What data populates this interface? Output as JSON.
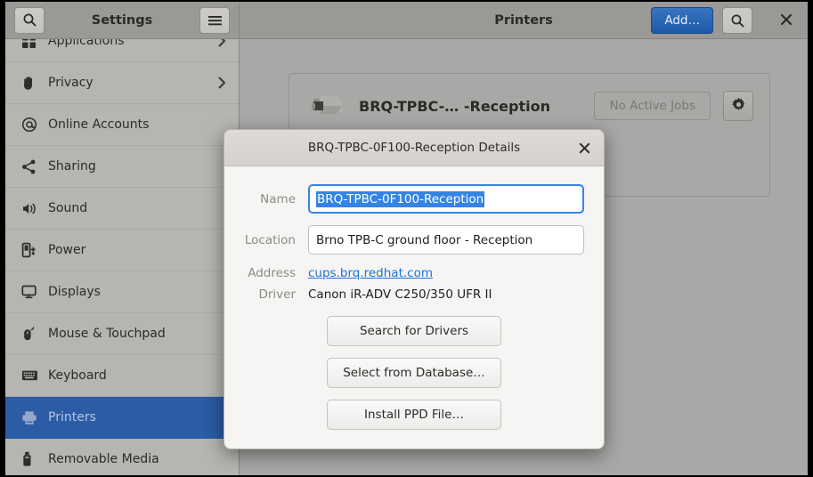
{
  "window": {
    "sidebar_title": "Settings",
    "content_title": "Printers"
  },
  "header": {
    "search_icon": "search-icon",
    "menu_icon": "hamburger-menu-icon",
    "add_label": "Add…",
    "content_search_icon": "search-icon",
    "close_icon": "close-icon"
  },
  "sidebar": {
    "items": [
      {
        "label": "Applications",
        "icon": "applications-grid-icon",
        "chevron": "›",
        "selected": false,
        "partial": true
      },
      {
        "label": "Privacy",
        "icon": "hand-icon",
        "chevron": "›",
        "selected": false
      },
      {
        "label": "Online Accounts",
        "icon": "at-sign-icon",
        "chevron": "",
        "selected": false
      },
      {
        "label": "Sharing",
        "icon": "share-nodes-icon",
        "chevron": "",
        "selected": false
      },
      {
        "label": "Sound",
        "icon": "speaker-icon",
        "chevron": "",
        "selected": false
      },
      {
        "label": "Power",
        "icon": "battery-plug-icon",
        "chevron": "",
        "selected": false
      },
      {
        "label": "Displays",
        "icon": "monitor-icon",
        "chevron": "",
        "selected": false
      },
      {
        "label": "Mouse & Touchpad",
        "icon": "mouse-icon",
        "chevron": "",
        "selected": false
      },
      {
        "label": "Keyboard",
        "icon": "keyboard-icon",
        "chevron": "",
        "selected": false
      },
      {
        "label": "Printers",
        "icon": "printer-icon",
        "chevron": "",
        "selected": true
      },
      {
        "label": "Removable Media",
        "icon": "usb-drive-icon",
        "chevron": "",
        "selected": false
      }
    ]
  },
  "printer_card": {
    "icon": "printer-icon",
    "name": "BRQ-TPBC-…  -Reception",
    "jobs_label": "No Active Jobs",
    "settings_icon": "gear-icon"
  },
  "dialog": {
    "title": "BRQ-TPBC-0F100-Reception Details",
    "close_icon": "close-icon",
    "fields": {
      "name_label": "Name",
      "name_value": "BRQ-TPBC-0F100-Reception",
      "location_label": "Location",
      "location_value": "Brno TPB-C ground floor - Reception",
      "address_label": "Address",
      "address_value": "cups.brq.redhat.com",
      "driver_label": "Driver",
      "driver_value": "Canon iR-ADV C250/350 UFR II"
    },
    "buttons": {
      "search_drivers": "Search for Drivers",
      "select_database": "Select from Database…",
      "install_ppd": "Install PPD File…"
    }
  },
  "colors": {
    "accent_blue": "#2b5ca5",
    "add_button_blue": "#1c5aa8",
    "selection_blue": "#3584e4",
    "link_blue": "#1c71d8",
    "sidebar_bg": "#b6b5b2",
    "content_bg": "#a8a8a6",
    "headerbar_bg": "#9b9996",
    "dialog_bg": "#f6f5f4",
    "dialog_header_bg": "#d5d2cd"
  }
}
